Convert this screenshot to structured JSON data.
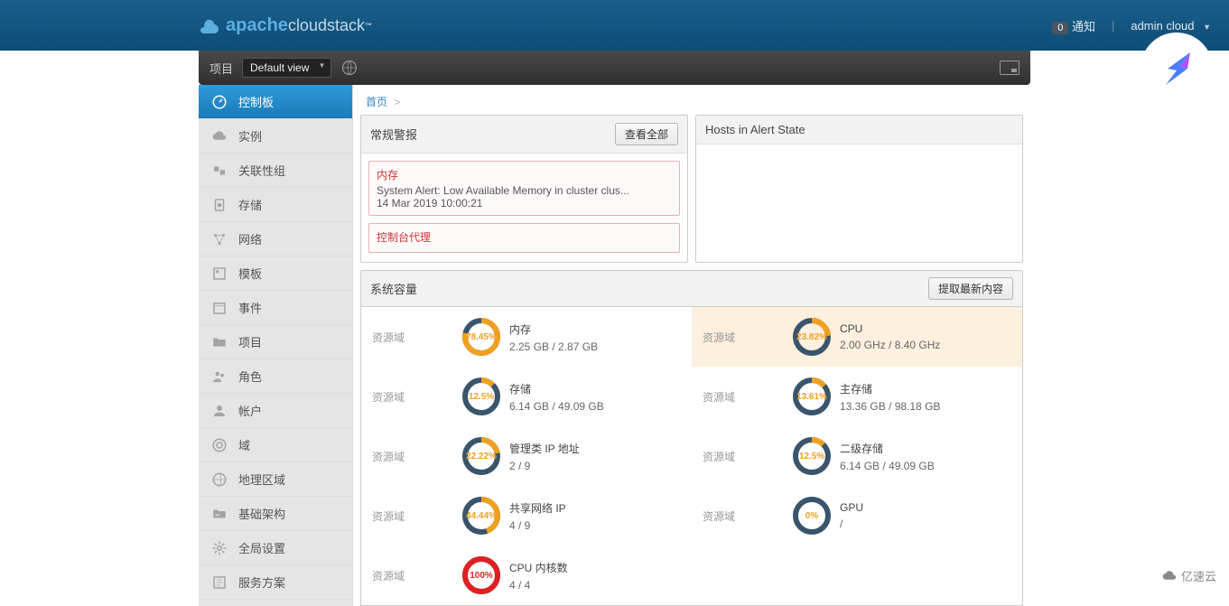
{
  "header": {
    "brand_main": "apache",
    "brand_sub": "cloudstack",
    "notif_count": "0",
    "notif_label": "通知",
    "user": "admin cloud"
  },
  "subheader": {
    "project_label": "项目",
    "project_value": "Default view"
  },
  "breadcrumb": {
    "home": "首页",
    "sep": ">"
  },
  "sidebar": {
    "items": [
      {
        "label": "控制板",
        "icon": "dashboard"
      },
      {
        "label": "实例",
        "icon": "cloud"
      },
      {
        "label": "关联性组",
        "icon": "group"
      },
      {
        "label": "存储",
        "icon": "disk"
      },
      {
        "label": "网络",
        "icon": "network"
      },
      {
        "label": "模板",
        "icon": "template"
      },
      {
        "label": "事件",
        "icon": "calendar"
      },
      {
        "label": "项目",
        "icon": "folder"
      },
      {
        "label": "角色",
        "icon": "users"
      },
      {
        "label": "帐户",
        "icon": "user"
      },
      {
        "label": "域",
        "icon": "target"
      },
      {
        "label": "地理区域",
        "icon": "globe"
      },
      {
        "label": "基础架构",
        "icon": "server"
      },
      {
        "label": "全局设置",
        "icon": "gear"
      },
      {
        "label": "服务方案",
        "icon": "offering"
      }
    ]
  },
  "alerts_panel": {
    "title": "常规警报",
    "view_all": "查看全部",
    "items": [
      {
        "title": "内存",
        "msg": "System Alert: Low Available Memory in cluster clus...",
        "time": "14 Mar 2019 10:00:21"
      },
      {
        "title": "控制台代理",
        "msg": ""
      }
    ]
  },
  "hosts_panel": {
    "title": "Hosts in Alert State"
  },
  "capacity": {
    "title": "系统容量",
    "fetch_btn": "提取最新内容",
    "zone_label": "资源域",
    "items": [
      {
        "name": "内存",
        "value": "2.25 GB / 2.87 GB",
        "pct": 78.45,
        "pct_text": "78.45%",
        "color": "#f0a020",
        "highlight": false
      },
      {
        "name": "CPU",
        "value": "2.00 GHz / 8.40 GHz",
        "pct": 23.82,
        "pct_text": "23.82%",
        "color": "#f0a020",
        "highlight": true
      },
      {
        "name": "存储",
        "value": "6.14 GB / 49.09 GB",
        "pct": 12.5,
        "pct_text": "12.5%",
        "color": "#f0a020",
        "highlight": false
      },
      {
        "name": "主存储",
        "value": "13.36 GB / 98.18 GB",
        "pct": 13.61,
        "pct_text": "13.61%",
        "color": "#f0a020",
        "highlight": false
      },
      {
        "name": "管理类 IP 地址",
        "value": "2 / 9",
        "pct": 22.22,
        "pct_text": "22.22%",
        "color": "#f0a020",
        "highlight": false
      },
      {
        "name": "二级存储",
        "value": "6.14 GB / 49.09 GB",
        "pct": 12.5,
        "pct_text": "12.5%",
        "color": "#f0a020",
        "highlight": false
      },
      {
        "name": "共享网络 IP",
        "value": "4 / 9",
        "pct": 44.44,
        "pct_text": "44.44%",
        "color": "#f0a020",
        "highlight": false
      },
      {
        "name": "GPU",
        "value": "/",
        "pct": 0,
        "pct_text": "0%",
        "color": "#f0a020",
        "highlight": false
      },
      {
        "name": "CPU 内核数",
        "value": "4 / 4",
        "pct": 100,
        "pct_text": "100%",
        "color": "#e02020",
        "highlight": false
      }
    ]
  },
  "footer": {
    "brand": "亿速云"
  }
}
